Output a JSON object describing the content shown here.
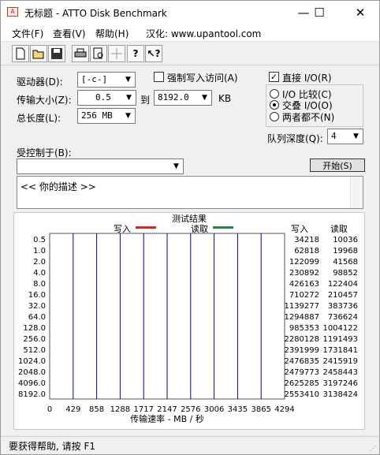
{
  "window": {
    "title": "无标题 - ATTO Disk Benchmark",
    "controls": {
      "minimize": "—",
      "maximize": "☐",
      "close": "✕"
    }
  },
  "menu": [
    {
      "label": "文件(F)"
    },
    {
      "label": "查看(V)"
    },
    {
      "label": "帮助(H)"
    },
    {
      "label": "汉化: www.upantool.com"
    }
  ],
  "toolbar": {
    "icons": [
      "new-icon",
      "open-icon",
      "save-icon",
      "print-icon",
      "print-preview-icon",
      "move-icon",
      "help-icon",
      "context-help-icon"
    ]
  },
  "settings": {
    "drive_label": "驱动器(D):",
    "drive_value": "[-c-]",
    "transfer_label": "传输大小(Z):",
    "transfer_from": "0.5",
    "transfer_to_label": "到",
    "transfer_to": "8192.0",
    "transfer_unit": "KB",
    "length_label": "总长度(L):",
    "length_value": "256 MB",
    "force_write_label": "强制写入访问(A)",
    "direct_io_label": "直接 I/O(R)",
    "io_compare_label": "I/O 比较(C)",
    "overlap_label": "交叠 I/O(O)",
    "neither_label": "两者都不(N)",
    "queue_label": "队列深度(Q):",
    "queue_value": "4",
    "controlled_label": "受控制于(B):",
    "controlled_value": "",
    "start_button": "开始(S)",
    "description": "<<  你的描述   >>"
  },
  "status": {
    "text": "要获得帮助, 请按 F1"
  },
  "chart_data": {
    "type": "bar",
    "orientation": "horizontal",
    "title": "测试结果",
    "legend": [
      "写入",
      "读取"
    ],
    "colors": {
      "write": "#ee1c1c",
      "read": "#1b8a3e",
      "grid": "#0000aa"
    },
    "categories": [
      "0.5",
      "1.0",
      "2.0",
      "4.0",
      "8.0",
      "16.0",
      "32.0",
      "64.0",
      "128.0",
      "256.0",
      "512.0",
      "1024.0",
      "2048.0",
      "4096.0",
      "8192.0"
    ],
    "series": [
      {
        "name": "写入",
        "values": [
          34218,
          62818,
          122099,
          230892,
          426163,
          710272,
          1139277,
          1294887,
          985353,
          2280128,
          2391999,
          2476835,
          2479773,
          2625285,
          2553410
        ]
      },
      {
        "name": "读取",
        "values": [
          10036,
          19968,
          41568,
          98852,
          122404,
          210457,
          383736,
          736624,
          1004122,
          1191493,
          1731841,
          2415919,
          2458443,
          3197246,
          3138424
        ]
      }
    ],
    "right_headers": [
      "写入",
      "读取"
    ],
    "x_ticks": [
      "0",
      "429",
      "858",
      "1288",
      "1717",
      "2147",
      "2576",
      "3006",
      "3435",
      "3865",
      "4294"
    ],
    "xlabel": "传输速率 - MB / 秒",
    "xlim_mb": [
      0,
      4294
    ]
  }
}
